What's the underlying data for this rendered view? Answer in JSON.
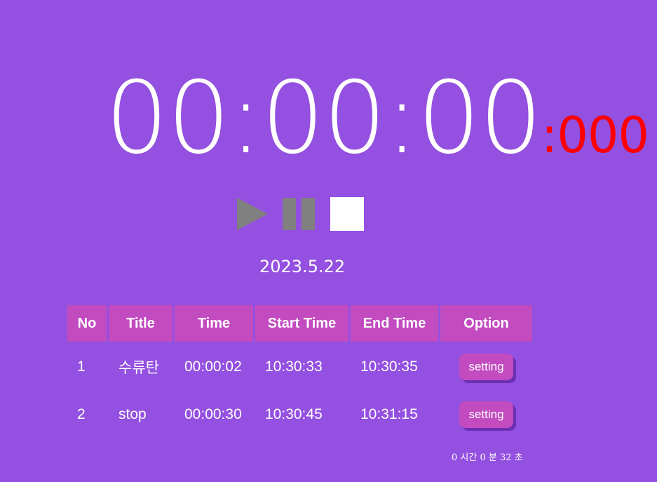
{
  "clock": {
    "main": "00:00:00",
    "ms": ":000"
  },
  "controls": {
    "play_icon": "play-icon",
    "pause_icon": "pause-icon",
    "stop_icon": "stop-icon",
    "active_color": "#ffffff",
    "inactive_color": "#808080"
  },
  "date": "2023.5.22",
  "table": {
    "headers": [
      "No",
      "Title",
      "Time",
      "Start Time",
      "End Time",
      "Option"
    ],
    "rows": [
      {
        "no": "1",
        "title": "수류탄",
        "time": "00:00:02",
        "start": "10:30:33",
        "end": "10:30:35",
        "option": "setting"
      },
      {
        "no": "2",
        "title": "stop",
        "time": "00:00:30",
        "start": "10:30:45",
        "end": "10:31:15",
        "option": "setting"
      }
    ]
  },
  "total": "0 시간 0 분 32 초",
  "colors": {
    "background": "#9450e0",
    "accent": "#c24bc0",
    "milliseconds": "#ff0000"
  }
}
